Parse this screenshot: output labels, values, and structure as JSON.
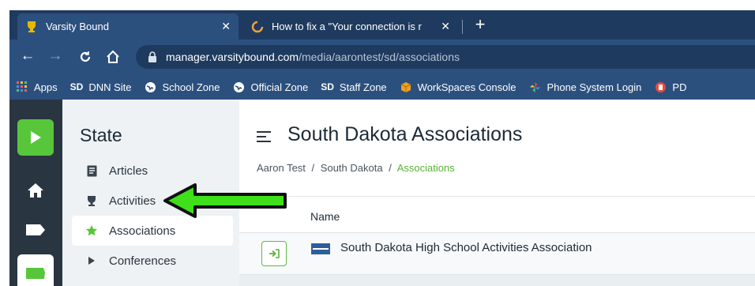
{
  "browser": {
    "tabs": [
      {
        "title": "Varsity Bound",
        "icon": "trophy-icon",
        "active": true
      },
      {
        "title": "How to fix a \"Your connection is r",
        "icon": "loading-circle-icon",
        "active": false
      }
    ],
    "url": {
      "host": "manager.varsitybound.com",
      "path": "/media/aarontest/sd/associations"
    },
    "bookmarks": [
      {
        "label": "Apps",
        "icon": "apps-grid-icon"
      },
      {
        "label": "DNN Site",
        "icon": "sd-icon",
        "prefix": "SD"
      },
      {
        "label": "School Zone",
        "icon": "globe-icon"
      },
      {
        "label": "Official Zone",
        "icon": "globe-icon"
      },
      {
        "label": "Staff Zone",
        "icon": "sd-icon",
        "prefix": "SD"
      },
      {
        "label": "WorkSpaces Console",
        "icon": "cube-icon"
      },
      {
        "label": "Phone System Login",
        "icon": "pinwheel-icon"
      },
      {
        "label": "PD",
        "icon": "pd-icon"
      }
    ]
  },
  "sidebar": {
    "title": "State",
    "items": [
      {
        "label": "Articles",
        "icon": "article-icon"
      },
      {
        "label": "Activities",
        "icon": "trophy-icon"
      },
      {
        "label": "Associations",
        "icon": "star-icon",
        "active": true
      },
      {
        "label": "Conferences",
        "icon": "triangle-right-icon"
      }
    ]
  },
  "main": {
    "title": "South Dakota Associations",
    "breadcrumb": {
      "parts": [
        "Aaron Test",
        "South Dakota"
      ],
      "separator": "/",
      "current": "Associations"
    },
    "table": {
      "column_name": "Name",
      "rows": [
        {
          "name": "South Dakota High School Activities Association"
        }
      ]
    }
  },
  "colors": {
    "chrome_dark": "#1f3a5f",
    "chrome": "#2c507e",
    "rail": "#2a3542",
    "accent_green": "#58c63a",
    "annotation_arrow": "#3fe01a"
  }
}
